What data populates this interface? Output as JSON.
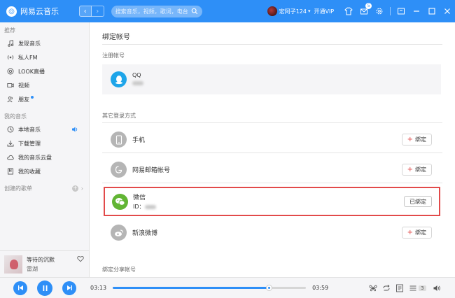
{
  "app": {
    "title": "网易云音乐",
    "logo_glyph": "◎"
  },
  "search": {
    "placeholder": "搜索音乐，视频，歌词，电台"
  },
  "user": {
    "name": "宏阿子124",
    "vip": "开通VIP"
  },
  "mail_badge": "5",
  "colors": {
    "brand": "#2e8ff7",
    "highlight": "#e24a4a",
    "wechat": "#62b534",
    "qq": "#1ea5e9"
  },
  "sidebar": {
    "recommend_title": "推荐",
    "recommend_items": [
      {
        "label": "发现音乐",
        "icon": "music-note-icon"
      },
      {
        "label": "私人FM",
        "icon": "radio-icon"
      },
      {
        "label": "LOOK直播",
        "icon": "live-icon"
      },
      {
        "label": "视频",
        "icon": "video-icon"
      },
      {
        "label": "朋友",
        "icon": "friends-icon"
      }
    ],
    "my_music_title": "我的音乐",
    "my_music_items": [
      {
        "label": "本地音乐",
        "icon": "local-music-icon"
      },
      {
        "label": "下载管理",
        "icon": "download-icon"
      },
      {
        "label": "我的音乐云盘",
        "icon": "cloud-icon"
      },
      {
        "label": "我的收藏",
        "icon": "collection-icon"
      }
    ],
    "created_playlists": "创建的歌单"
  },
  "now_playing": {
    "title": "等待的沉默",
    "artist": "雷湖"
  },
  "main": {
    "page_title": "绑定帐号",
    "registered_label": "注册帐号",
    "qq_name": "QQ",
    "other_label": "其它登录方式",
    "rows": {
      "phone": "手机",
      "email": "网易邮箱帐号",
      "weibo": "新浪微博"
    },
    "wechat": {
      "name": "微信",
      "id_label": "ID："
    },
    "bind_label": "绑定",
    "bound_label": "已绑定",
    "share_label": "绑定分享帐号"
  },
  "player": {
    "current_time": "03:13",
    "total_time": "03:59",
    "progress": 0.81,
    "playlist_count": "3"
  }
}
